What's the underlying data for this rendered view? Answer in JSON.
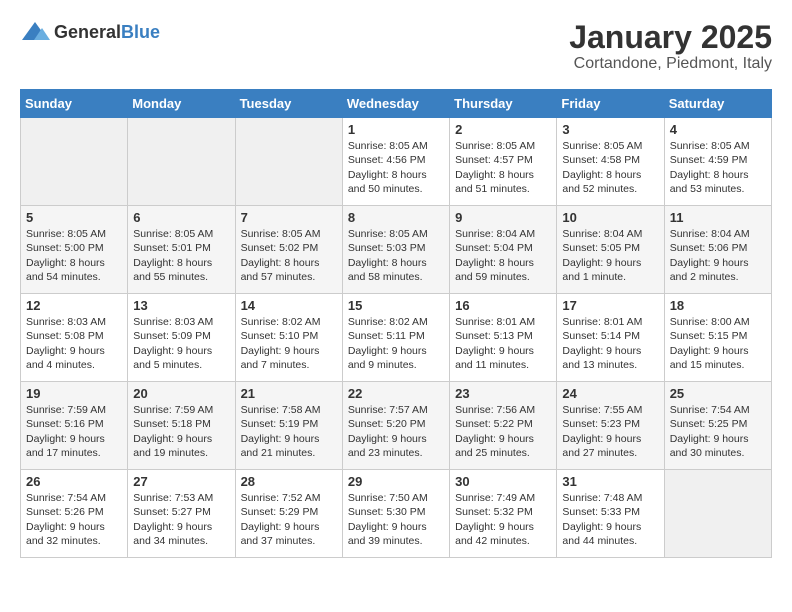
{
  "logo": {
    "general": "General",
    "blue": "Blue"
  },
  "header": {
    "title": "January 2025",
    "subtitle": "Cortandone, Piedmont, Italy"
  },
  "weekdays": [
    "Sunday",
    "Monday",
    "Tuesday",
    "Wednesday",
    "Thursday",
    "Friday",
    "Saturday"
  ],
  "weeks": [
    [
      {
        "day": "",
        "info": ""
      },
      {
        "day": "",
        "info": ""
      },
      {
        "day": "",
        "info": ""
      },
      {
        "day": "1",
        "info": "Sunrise: 8:05 AM\nSunset: 4:56 PM\nDaylight: 8 hours\nand 50 minutes."
      },
      {
        "day": "2",
        "info": "Sunrise: 8:05 AM\nSunset: 4:57 PM\nDaylight: 8 hours\nand 51 minutes."
      },
      {
        "day": "3",
        "info": "Sunrise: 8:05 AM\nSunset: 4:58 PM\nDaylight: 8 hours\nand 52 minutes."
      },
      {
        "day": "4",
        "info": "Sunrise: 8:05 AM\nSunset: 4:59 PM\nDaylight: 8 hours\nand 53 minutes."
      }
    ],
    [
      {
        "day": "5",
        "info": "Sunrise: 8:05 AM\nSunset: 5:00 PM\nDaylight: 8 hours\nand 54 minutes."
      },
      {
        "day": "6",
        "info": "Sunrise: 8:05 AM\nSunset: 5:01 PM\nDaylight: 8 hours\nand 55 minutes."
      },
      {
        "day": "7",
        "info": "Sunrise: 8:05 AM\nSunset: 5:02 PM\nDaylight: 8 hours\nand 57 minutes."
      },
      {
        "day": "8",
        "info": "Sunrise: 8:05 AM\nSunset: 5:03 PM\nDaylight: 8 hours\nand 58 minutes."
      },
      {
        "day": "9",
        "info": "Sunrise: 8:04 AM\nSunset: 5:04 PM\nDaylight: 8 hours\nand 59 minutes."
      },
      {
        "day": "10",
        "info": "Sunrise: 8:04 AM\nSunset: 5:05 PM\nDaylight: 9 hours\nand 1 minute."
      },
      {
        "day": "11",
        "info": "Sunrise: 8:04 AM\nSunset: 5:06 PM\nDaylight: 9 hours\nand 2 minutes."
      }
    ],
    [
      {
        "day": "12",
        "info": "Sunrise: 8:03 AM\nSunset: 5:08 PM\nDaylight: 9 hours\nand 4 minutes."
      },
      {
        "day": "13",
        "info": "Sunrise: 8:03 AM\nSunset: 5:09 PM\nDaylight: 9 hours\nand 5 minutes."
      },
      {
        "day": "14",
        "info": "Sunrise: 8:02 AM\nSunset: 5:10 PM\nDaylight: 9 hours\nand 7 minutes."
      },
      {
        "day": "15",
        "info": "Sunrise: 8:02 AM\nSunset: 5:11 PM\nDaylight: 9 hours\nand 9 minutes."
      },
      {
        "day": "16",
        "info": "Sunrise: 8:01 AM\nSunset: 5:13 PM\nDaylight: 9 hours\nand 11 minutes."
      },
      {
        "day": "17",
        "info": "Sunrise: 8:01 AM\nSunset: 5:14 PM\nDaylight: 9 hours\nand 13 minutes."
      },
      {
        "day": "18",
        "info": "Sunrise: 8:00 AM\nSunset: 5:15 PM\nDaylight: 9 hours\nand 15 minutes."
      }
    ],
    [
      {
        "day": "19",
        "info": "Sunrise: 7:59 AM\nSunset: 5:16 PM\nDaylight: 9 hours\nand 17 minutes."
      },
      {
        "day": "20",
        "info": "Sunrise: 7:59 AM\nSunset: 5:18 PM\nDaylight: 9 hours\nand 19 minutes."
      },
      {
        "day": "21",
        "info": "Sunrise: 7:58 AM\nSunset: 5:19 PM\nDaylight: 9 hours\nand 21 minutes."
      },
      {
        "day": "22",
        "info": "Sunrise: 7:57 AM\nSunset: 5:20 PM\nDaylight: 9 hours\nand 23 minutes."
      },
      {
        "day": "23",
        "info": "Sunrise: 7:56 AM\nSunset: 5:22 PM\nDaylight: 9 hours\nand 25 minutes."
      },
      {
        "day": "24",
        "info": "Sunrise: 7:55 AM\nSunset: 5:23 PM\nDaylight: 9 hours\nand 27 minutes."
      },
      {
        "day": "25",
        "info": "Sunrise: 7:54 AM\nSunset: 5:25 PM\nDaylight: 9 hours\nand 30 minutes."
      }
    ],
    [
      {
        "day": "26",
        "info": "Sunrise: 7:54 AM\nSunset: 5:26 PM\nDaylight: 9 hours\nand 32 minutes."
      },
      {
        "day": "27",
        "info": "Sunrise: 7:53 AM\nSunset: 5:27 PM\nDaylight: 9 hours\nand 34 minutes."
      },
      {
        "day": "28",
        "info": "Sunrise: 7:52 AM\nSunset: 5:29 PM\nDaylight: 9 hours\nand 37 minutes."
      },
      {
        "day": "29",
        "info": "Sunrise: 7:50 AM\nSunset: 5:30 PM\nDaylight: 9 hours\nand 39 minutes."
      },
      {
        "day": "30",
        "info": "Sunrise: 7:49 AM\nSunset: 5:32 PM\nDaylight: 9 hours\nand 42 minutes."
      },
      {
        "day": "31",
        "info": "Sunrise: 7:48 AM\nSunset: 5:33 PM\nDaylight: 9 hours\nand 44 minutes."
      },
      {
        "day": "",
        "info": ""
      }
    ]
  ]
}
